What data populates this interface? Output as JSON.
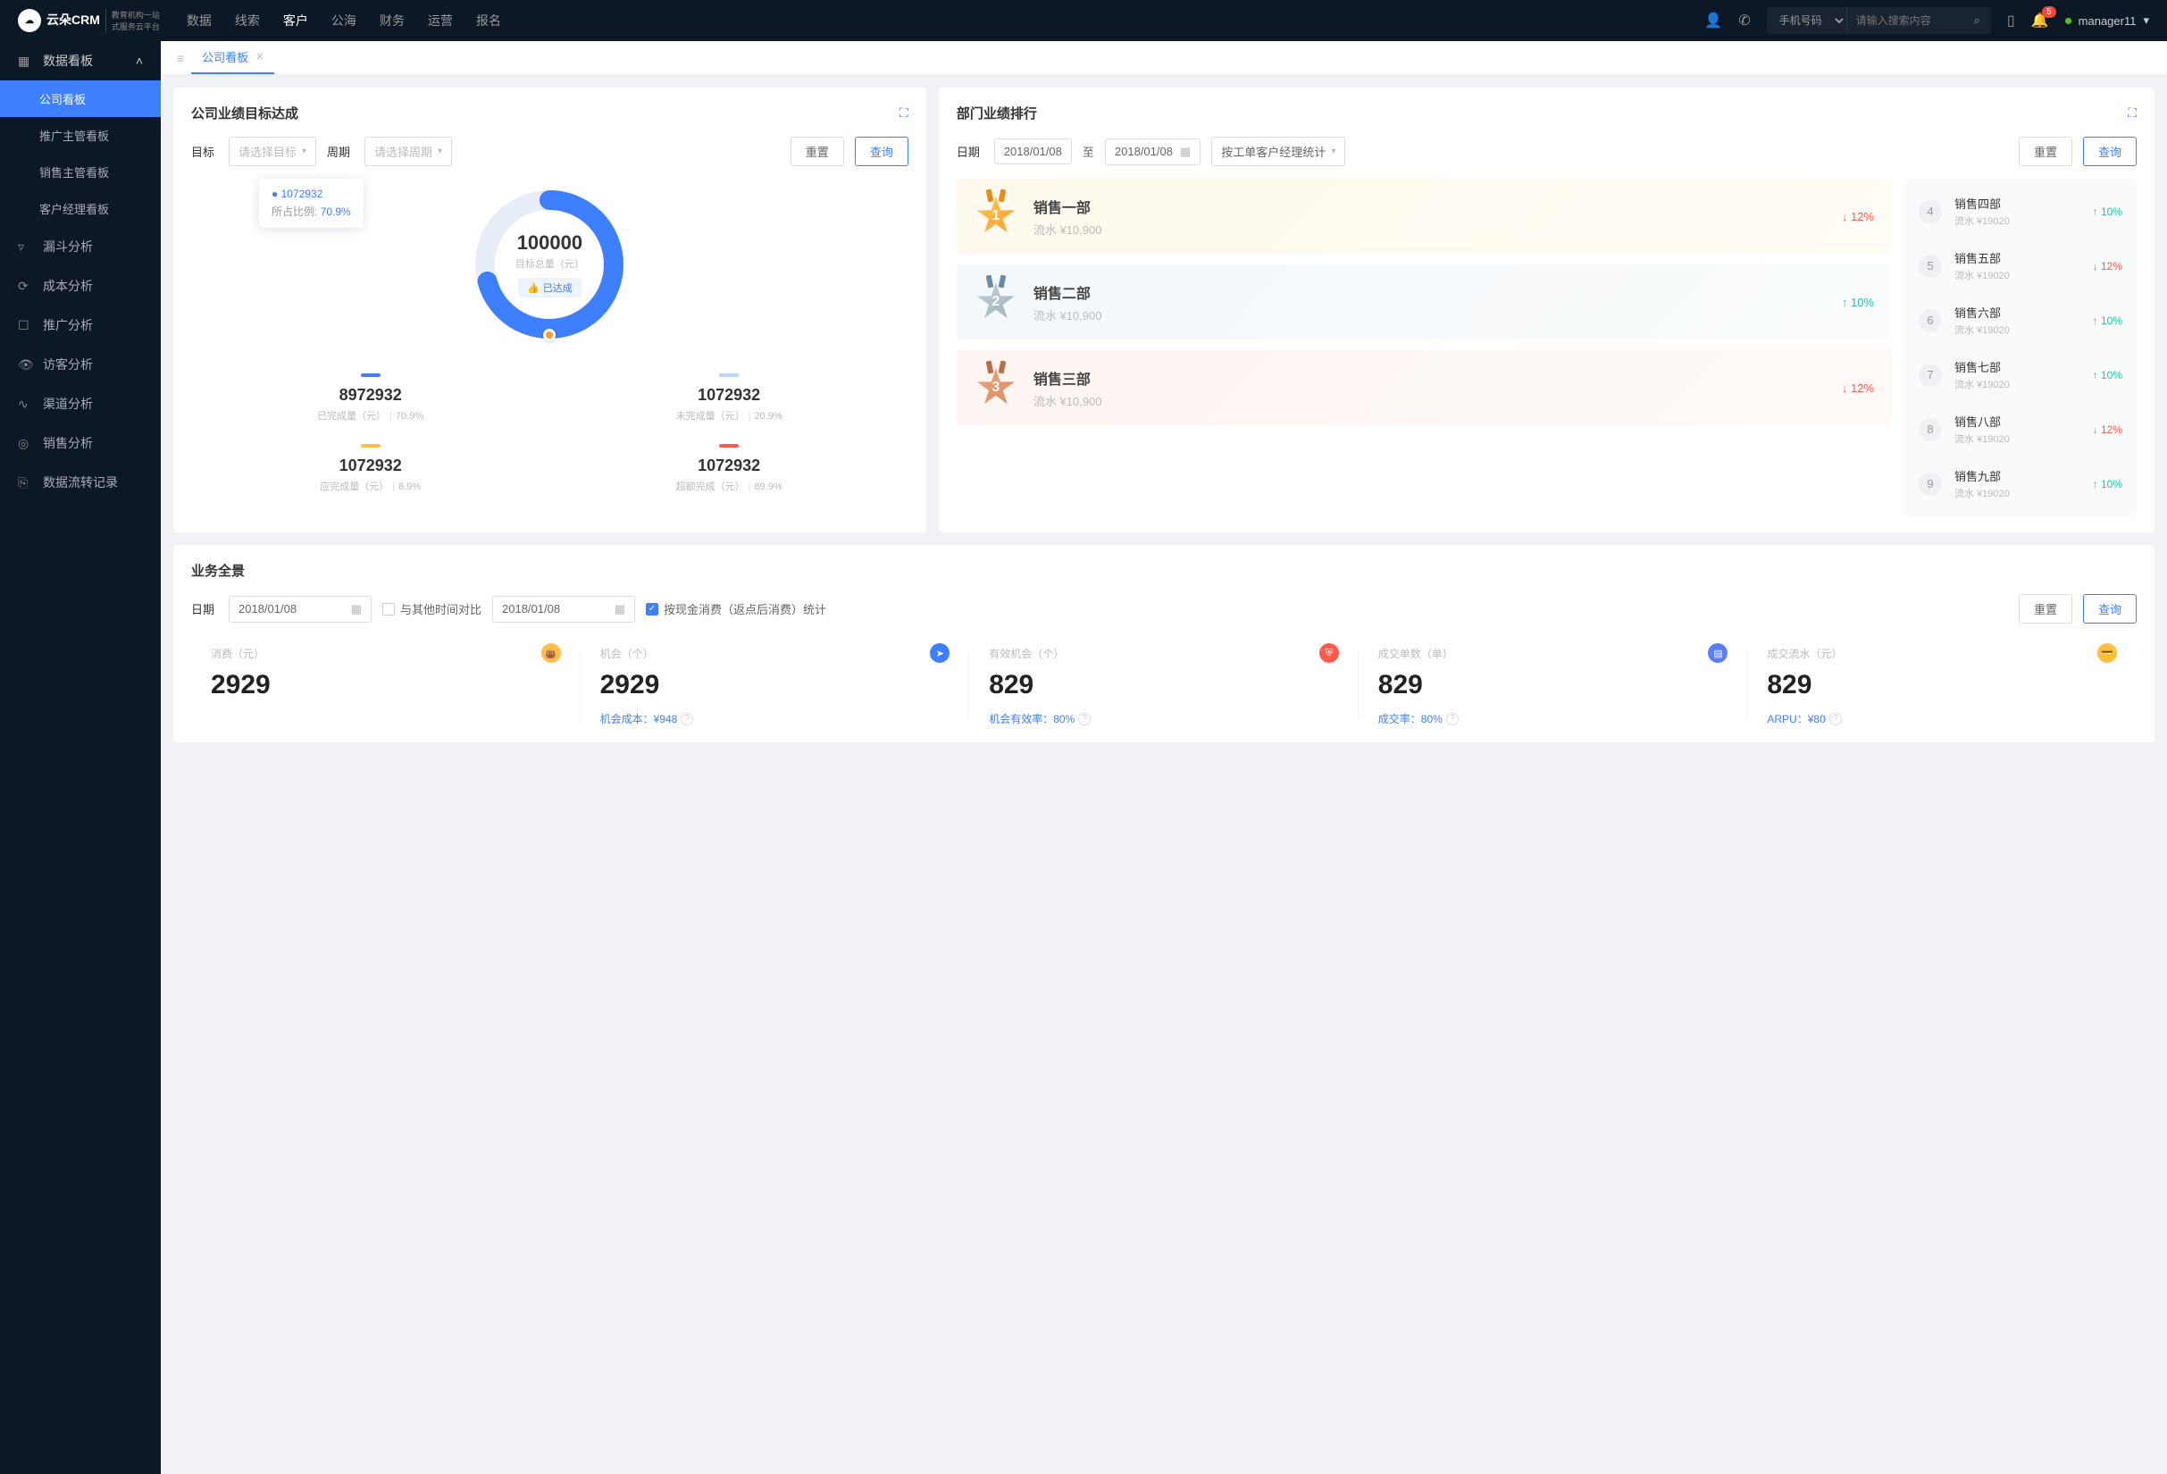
{
  "brand": {
    "main": "云朵CRM",
    "sub1": "教育机构一站",
    "sub2": "式服务云平台"
  },
  "topnav": {
    "items": [
      "数据",
      "线索",
      "客户",
      "公海",
      "财务",
      "运营",
      "报名"
    ],
    "active": "客户"
  },
  "search": {
    "type": "手机号码",
    "placeholder": "请输入搜索内容"
  },
  "notif_count": "5",
  "user": {
    "name": "manager11"
  },
  "sidebar": {
    "group": {
      "label": "数据看板",
      "items": [
        "公司看板",
        "推广主管看板",
        "销售主管看板",
        "客户经理看板"
      ],
      "active": "公司看板"
    },
    "singles": [
      "漏斗分析",
      "成本分析",
      "推广分析",
      "访客分析",
      "渠道分析",
      "销售分析",
      "数据流转记录"
    ]
  },
  "tabs": {
    "active": "公司看板"
  },
  "goal": {
    "title": "公司业绩目标达成",
    "labels": {
      "target": "目标",
      "period": "周期"
    },
    "placeholders": {
      "target": "请选择目标",
      "period": "请选择周期"
    },
    "btn_reset": "重置",
    "btn_query": "查询",
    "tooltip": {
      "value": "1072932",
      "ratio_label": "所占比例:",
      "ratio": "70.9%"
    },
    "center": {
      "total": "100000",
      "total_label": "目标总量（元）",
      "status": "已达成"
    },
    "metrics": [
      {
        "bar": "#3d7fff",
        "value": "8972932",
        "label": "已完成量（元）",
        "pct": "70.9%"
      },
      {
        "bar": "#bcd5ff",
        "value": "1072932",
        "label": "未完成量（元）",
        "pct": "20.9%"
      },
      {
        "bar": "#ffbf47",
        "value": "1072932",
        "label": "应完成量（元）",
        "pct": "8.9%"
      },
      {
        "bar": "#ff5b4c",
        "value": "1072932",
        "label": "超额完成（元）",
        "pct": "89.9%"
      }
    ]
  },
  "rank": {
    "title": "部门业绩排行",
    "labels": {
      "date": "日期",
      "to": "至"
    },
    "dates": {
      "from": "2018/01/08",
      "to": "2018/01/08"
    },
    "mode": "按工单客户经理统计",
    "btn_reset": "重置",
    "btn_query": "查询",
    "top3": [
      {
        "n": "1",
        "name": "销售一部",
        "flow": "流水 ¥10,900",
        "dir": "down",
        "pct": "12%"
      },
      {
        "n": "2",
        "name": "销售二部",
        "flow": "流水 ¥10,900",
        "dir": "up",
        "pct": "10%"
      },
      {
        "n": "3",
        "name": "销售三部",
        "flow": "流水 ¥10,900",
        "dir": "down",
        "pct": "12%"
      }
    ],
    "rest": [
      {
        "n": "4",
        "name": "销售四部",
        "flow": "流水 ¥19020",
        "dir": "up",
        "pct": "10%"
      },
      {
        "n": "5",
        "name": "销售五部",
        "flow": "流水 ¥19020",
        "dir": "down",
        "pct": "12%"
      },
      {
        "n": "6",
        "name": "销售六部",
        "flow": "流水 ¥19020",
        "dir": "up",
        "pct": "10%"
      },
      {
        "n": "7",
        "name": "销售七部",
        "flow": "流水 ¥19020",
        "dir": "up",
        "pct": "10%"
      },
      {
        "n": "8",
        "name": "销售八部",
        "flow": "流水 ¥19020",
        "dir": "down",
        "pct": "12%"
      },
      {
        "n": "9",
        "name": "销售九部",
        "flow": "流水 ¥19020",
        "dir": "up",
        "pct": "10%"
      }
    ]
  },
  "overview": {
    "title": "业务全景",
    "labels": {
      "date": "日期",
      "compare": "与其他时间对比",
      "rebate": "按现金消费（返点后消费）统计"
    },
    "date1": "2018/01/08",
    "date2": "2018/01/08",
    "btn_reset": "重置",
    "btn_query": "查询",
    "kpis": [
      {
        "head": "消费（元）",
        "icon_bg": "#ffbf47",
        "icon": "bag",
        "value": "2929",
        "foot": ""
      },
      {
        "head": "机会（个）",
        "icon_bg": "#3d7fff",
        "icon": "send",
        "value": "2929",
        "foot": "机会成本：¥948"
      },
      {
        "head": "有效机会（个）",
        "icon_bg": "#ff5b4c",
        "icon": "shield",
        "value": "829",
        "foot": "机会有效率：80%"
      },
      {
        "head": "成交单数（单）",
        "icon_bg": "#5b7cff",
        "icon": "list",
        "value": "829",
        "foot": "成交率：80%"
      },
      {
        "head": "成交流水（元）",
        "icon_bg": "#ffbf47",
        "icon": "card",
        "value": "829",
        "foot": "ARPU：¥80"
      }
    ]
  },
  "chart_data": {
    "type": "pie",
    "title": "目标总量（元）",
    "total": 100000,
    "series": [
      {
        "name": "已完成量（元）",
        "value": 8972932,
        "pct": 70.9,
        "color": "#3d7fff"
      },
      {
        "name": "未完成量（元）",
        "value": 1072932,
        "pct": 20.9,
        "color": "#bcd5ff"
      },
      {
        "name": "应完成量（元）",
        "value": 1072932,
        "pct": 8.9,
        "color": "#ffbf47"
      },
      {
        "name": "超额完成（元）",
        "value": 1072932,
        "pct": 89.9,
        "color": "#ff5b4c"
      }
    ],
    "status": "已达成"
  }
}
